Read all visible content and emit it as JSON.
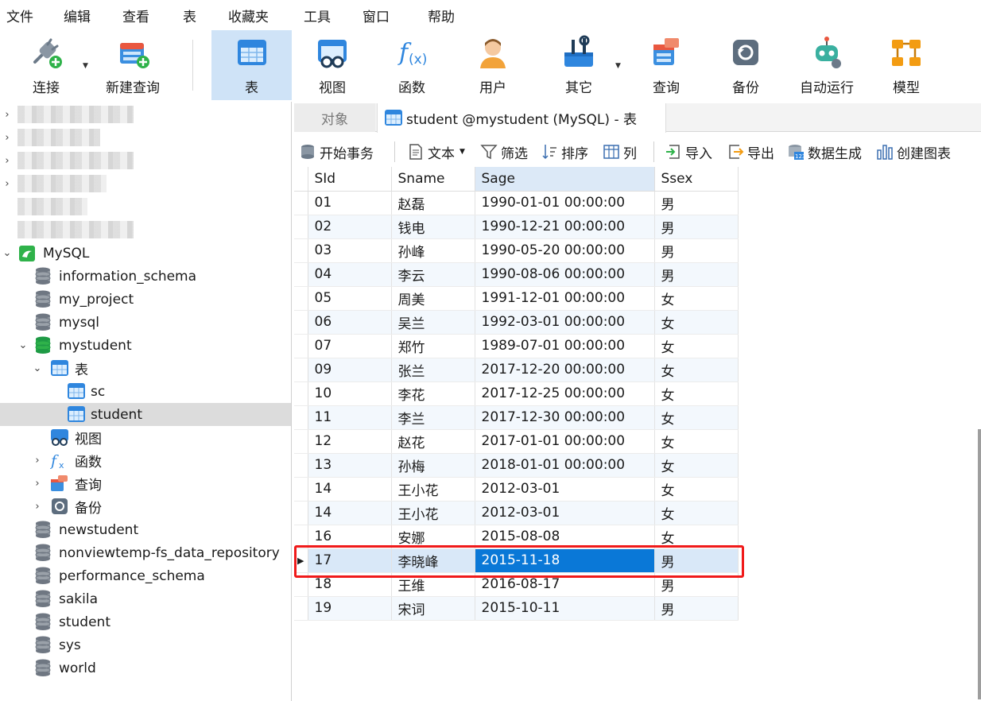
{
  "menu": [
    "文件",
    "编辑",
    "查看",
    "表",
    "收藏夹",
    "工具",
    "窗口",
    "帮助"
  ],
  "toolbar": {
    "connect": "连接",
    "new_query": "新建查询",
    "table": "表",
    "view": "视图",
    "function": "函数",
    "user": "用户",
    "other": "其它",
    "query": "查询",
    "backup": "备份",
    "automation": "自动运行",
    "model": "模型"
  },
  "sidebar": {
    "connection": "MySQL",
    "databases": [
      "information_schema",
      "my_project",
      "mysql",
      "mystudent",
      "newstudent",
      "nonviewtemp-fs_data_repository",
      "performance_schema",
      "sakila",
      "student",
      "sys",
      "world"
    ],
    "mystudent_children": {
      "tables_label": "表",
      "tables": [
        "sc",
        "student"
      ],
      "views_label": "视图",
      "functions_label": "函数",
      "queries_label": "查询",
      "backups_label": "备份"
    }
  },
  "tabs": {
    "objects": "对象",
    "active": "student @mystudent (MySQL) - 表"
  },
  "subtoolbar": {
    "begin_transaction": "开始事务",
    "text": "文本",
    "filter": "筛选",
    "sort": "排序",
    "columns": "列",
    "import": "导入",
    "export": "导出",
    "data_generation": "数据生成",
    "create_chart": "创建图表"
  },
  "grid": {
    "columns": [
      "SId",
      "Sname",
      "Sage",
      "Ssex"
    ],
    "rows": [
      [
        "01",
        "赵磊",
        "1990-01-01 00:00:00",
        "男"
      ],
      [
        "02",
        "钱电",
        "1990-12-21 00:00:00",
        "男"
      ],
      [
        "03",
        "孙峰",
        "1990-05-20 00:00:00",
        "男"
      ],
      [
        "04",
        "李云",
        "1990-08-06 00:00:00",
        "男"
      ],
      [
        "05",
        "周美",
        "1991-12-01 00:00:00",
        "女"
      ],
      [
        "06",
        "吴兰",
        "1992-03-01 00:00:00",
        "女"
      ],
      [
        "07",
        "郑竹",
        "1989-07-01 00:00:00",
        "女"
      ],
      [
        "09",
        "张兰",
        "2017-12-20 00:00:00",
        "女"
      ],
      [
        "10",
        "李花",
        "2017-12-25 00:00:00",
        "女"
      ],
      [
        "11",
        "李兰",
        "2017-12-30 00:00:00",
        "女"
      ],
      [
        "12",
        "赵花",
        "2017-01-01 00:00:00",
        "女"
      ],
      [
        "13",
        "孙梅",
        "2018-01-01 00:00:00",
        "女"
      ],
      [
        "14",
        "王小花",
        "2012-03-01",
        "女"
      ],
      [
        "14",
        "王小花",
        "2012-03-01",
        "女"
      ],
      [
        "16",
        "安娜",
        "2015-08-08",
        "女"
      ],
      [
        "17",
        "李晓峰",
        "2015-11-18",
        "男"
      ],
      [
        "18",
        "王维",
        "2016-08-17",
        "男"
      ],
      [
        "19",
        "宋词",
        "2015-10-11",
        "男"
      ]
    ],
    "current_row_index": 15,
    "editing_column_index": 2
  }
}
